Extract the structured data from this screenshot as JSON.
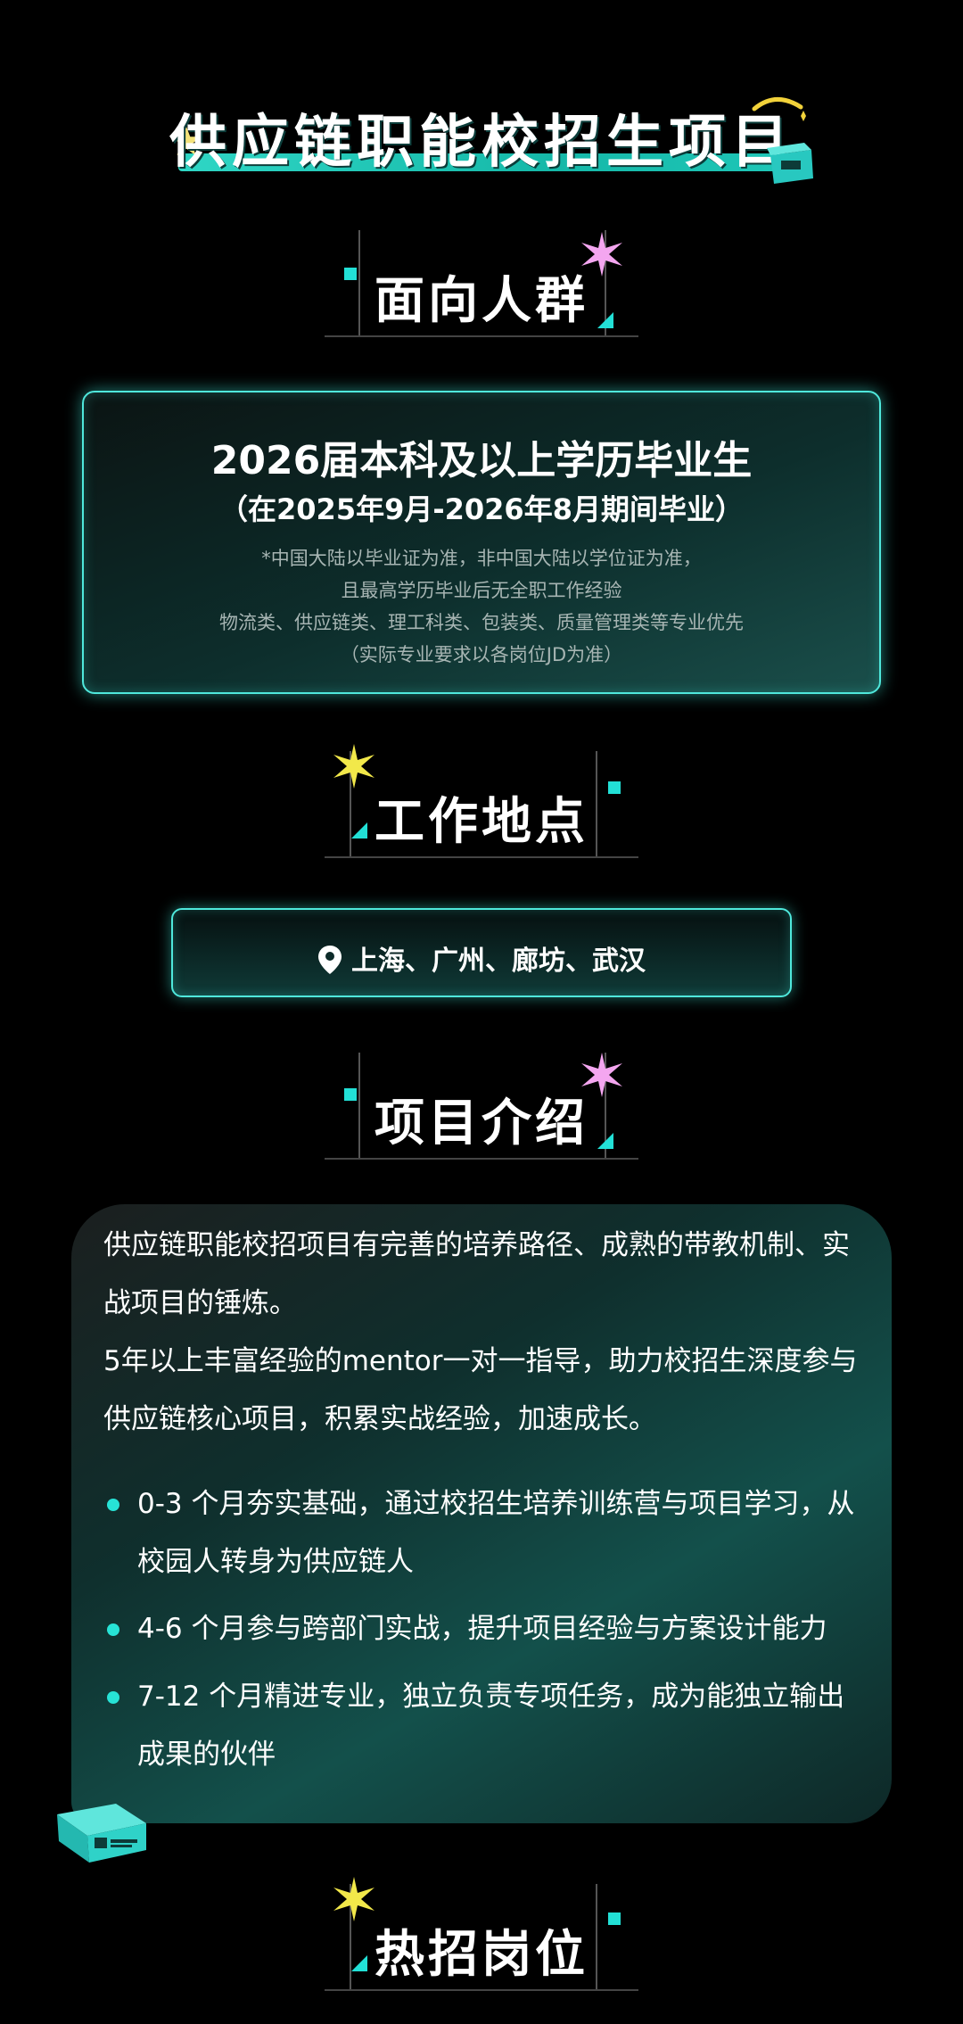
{
  "banner": {
    "title": "供应链职能校招生项目"
  },
  "sections": {
    "audience": "面向人群",
    "location": "工作地点",
    "intro": "项目介绍",
    "jobs": "热招岗位"
  },
  "audience": {
    "main": "2026届本科及以上学历毕业生",
    "sub": "（在2025年9月-2026年8月期间毕业）",
    "notes": [
      "*中国大陆以毕业证为准，非中国大陆以学位证为准，",
      "且最高学历毕业后无全职工作经验",
      "物流类、供应链类、理工科类、包装类、质量管理类等专业优先",
      "（实际专业要求以各岗位JD为准）"
    ]
  },
  "location": {
    "text": "上海、广州、廊坊、武汉",
    "icon": "location-pin-icon"
  },
  "intro": {
    "paragraphs": [
      "供应链职能校招项目有完善的培养路径、成熟的带教机制、实战项目的锤炼。",
      "5年以上丰富经验的mentor一对一指导，助力校招生深度参与供应链核心项目，积累实战经验，加速成长。"
    ],
    "bullets": [
      "0-3 个月夯实基础，通过校招生培养训练营与项目学习，从校园人转身为供应链人",
      "4-6 个月参与跨部门实战，提升项目经验与方案设计能力",
      "7-12 个月精进专业，独立负责专项任务，成为能独立输出成果的伙伴"
    ]
  },
  "colors": {
    "accent": "#22e0d6",
    "spark_pink": "#f4a6f0",
    "spark_yellow": "#f2e84a"
  }
}
